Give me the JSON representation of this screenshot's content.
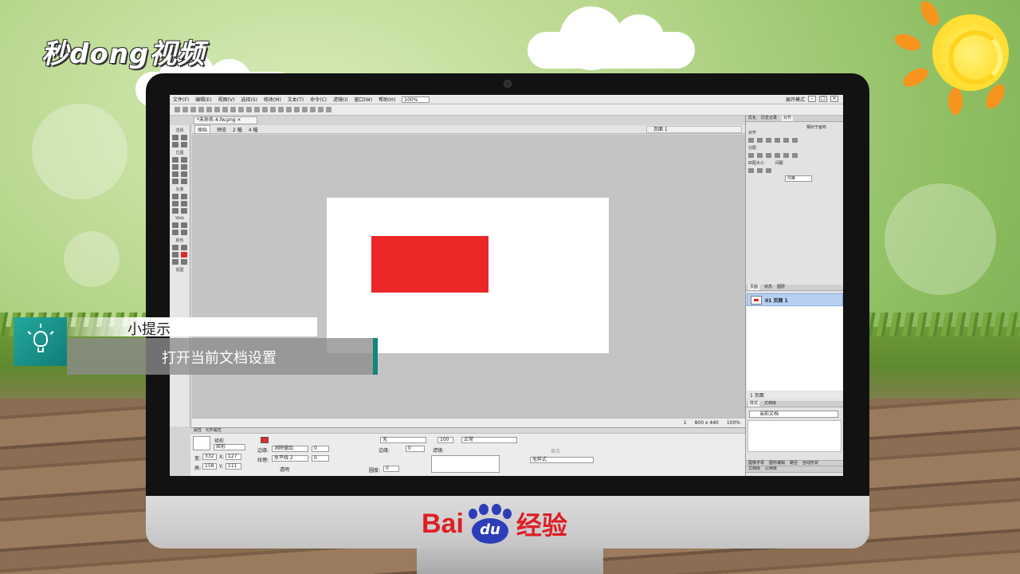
{
  "overlay": {
    "brand_logo": "秒dong视频",
    "tip_title": "小提示",
    "tip_text": "打开当前文档设置",
    "tip_icon": "lightbulb-icon"
  },
  "monitor": {
    "brand": {
      "text_left": "Bai",
      "paw_text": "du",
      "text_right": "经验"
    }
  },
  "app": {
    "menu": [
      "文件(F)",
      "编辑(E)",
      "视图(V)",
      "选择(S)",
      "修改(M)",
      "文本(T)",
      "命令(C)",
      "滤镜(I)",
      "窗口(W)",
      "帮助(H)"
    ],
    "zoom": "100%",
    "workspace_mode": "展开模式",
    "document_tab": "*未命名-4.fw.png ×",
    "view_tabs": [
      "原始",
      "预览",
      "2 幅",
      "4 幅"
    ],
    "page_label": "页面 1",
    "tool_sections": [
      "选择",
      "位图",
      "矢量",
      "Web",
      "颜色",
      "视图"
    ],
    "canvas": {
      "size_text": "800 x 440",
      "zoom_text": "100%",
      "frame_text": "1"
    },
    "properties": {
      "panel_tabs": [
        "属性",
        "元件属性"
      ],
      "object_type": "矩形",
      "object_name": "矩形",
      "width_label": "宽:",
      "width": "332",
      "height_label": "高:",
      "height": "158",
      "x_label": "X:",
      "x": "127",
      "y_label": "Y:",
      "y": "111",
      "edge_label": "边缘:",
      "edge_value": "消除锯齿",
      "edge_px": "0",
      "texture_label": "纹理:",
      "texture_value": "水平线 2",
      "texture_pct": "0",
      "transparent_label": "透明",
      "stroke_none": "无",
      "stroke_edge_label": "边缘:",
      "stroke_edge_value": "0",
      "roundness_label": "圆度:",
      "roundness": "0",
      "opacity": "100",
      "blend": "正常",
      "filters_label": "滤镜:",
      "style_value": "无样式",
      "snap_label": "宿合"
    },
    "panels": {
      "top_tabs": [
        "优化",
        "历史记录",
        "对齐"
      ],
      "align_to": "相对于画布",
      "align_label": "对齐",
      "distribute_label": "分配",
      "match_size_label": "匹配大小",
      "space_label": "间距",
      "space_value": "均等",
      "pages_tabs": [
        "页面",
        "状态",
        "图层"
      ],
      "pages": [
        {
          "label": "01 页面 1"
        }
      ],
      "pages_footer": "1 页面",
      "styles_tabs": [
        "样式",
        "文档库"
      ],
      "styles_select": "当前文档",
      "bottom_tabs": [
        "图像字母",
        "图形编辑",
        "路径",
        "自动形状"
      ],
      "bottom_tabs2": [
        "文档库",
        "公用库"
      ]
    }
  }
}
